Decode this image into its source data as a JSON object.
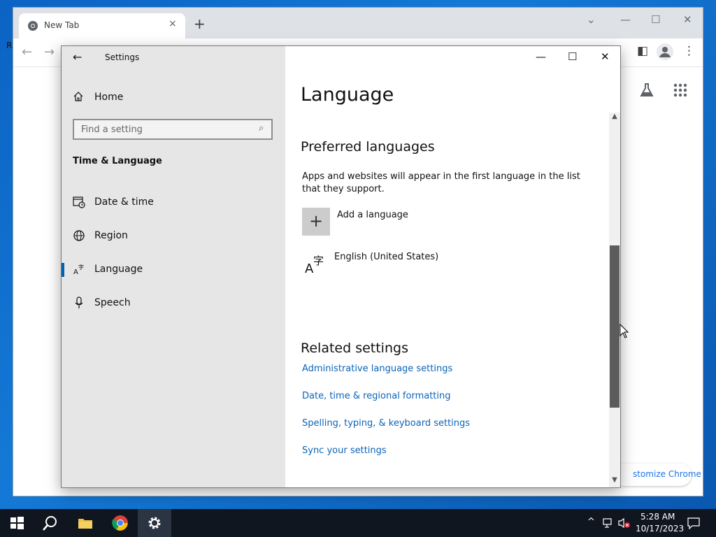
{
  "desktop": {
    "partial_label": "R"
  },
  "browser": {
    "tab_title": "New Tab",
    "tab_close": "×",
    "new_tab": "+",
    "customize_label": "stomize Chrome"
  },
  "settings": {
    "app_title": "Settings",
    "home_label": "Home",
    "search_placeholder": "Find a setting",
    "section_header": "Time & Language",
    "nav_items": [
      {
        "label": "Date & time",
        "icon": "calendar-clock-icon"
      },
      {
        "label": "Region",
        "icon": "globe-icon"
      },
      {
        "label": "Language",
        "icon": "language-icon",
        "active": true
      },
      {
        "label": "Speech",
        "icon": "microphone-icon"
      }
    ],
    "page_title": "Language",
    "preferred_heading": "Preferred languages",
    "preferred_desc": "Apps and websites will appear in the first language in the list that they support.",
    "add_language": "Add a language",
    "installed_language": "English (United States)",
    "related_heading": "Related settings",
    "related_links": [
      "Administrative language settings",
      "Date, time & regional formatting",
      "Spelling, typing, & keyboard settings",
      "Sync your settings"
    ]
  },
  "taskbar": {
    "time": "5:28 AM",
    "date": "10/17/2023"
  },
  "colors": {
    "accent": "#0063b1",
    "link": "#0b64b8",
    "sidebar_bg": "#e6e6e6",
    "taskbar_bg": "#10161f"
  }
}
